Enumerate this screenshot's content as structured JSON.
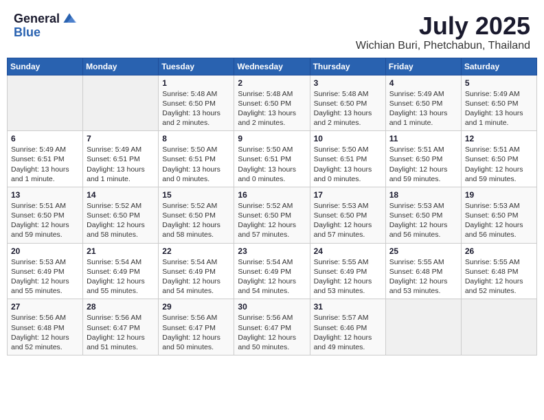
{
  "header": {
    "logo_general": "General",
    "logo_blue": "Blue",
    "month": "July 2025",
    "location": "Wichian Buri, Phetchabun, Thailand"
  },
  "weekdays": [
    "Sunday",
    "Monday",
    "Tuesday",
    "Wednesday",
    "Thursday",
    "Friday",
    "Saturday"
  ],
  "weeks": [
    [
      {
        "day": "",
        "info": ""
      },
      {
        "day": "",
        "info": ""
      },
      {
        "day": "1",
        "info": "Sunrise: 5:48 AM\nSunset: 6:50 PM\nDaylight: 13 hours and 2 minutes."
      },
      {
        "day": "2",
        "info": "Sunrise: 5:48 AM\nSunset: 6:50 PM\nDaylight: 13 hours and 2 minutes."
      },
      {
        "day": "3",
        "info": "Sunrise: 5:48 AM\nSunset: 6:50 PM\nDaylight: 13 hours and 2 minutes."
      },
      {
        "day": "4",
        "info": "Sunrise: 5:49 AM\nSunset: 6:50 PM\nDaylight: 13 hours and 1 minute."
      },
      {
        "day": "5",
        "info": "Sunrise: 5:49 AM\nSunset: 6:50 PM\nDaylight: 13 hours and 1 minute."
      }
    ],
    [
      {
        "day": "6",
        "info": "Sunrise: 5:49 AM\nSunset: 6:51 PM\nDaylight: 13 hours and 1 minute."
      },
      {
        "day": "7",
        "info": "Sunrise: 5:49 AM\nSunset: 6:51 PM\nDaylight: 13 hours and 1 minute."
      },
      {
        "day": "8",
        "info": "Sunrise: 5:50 AM\nSunset: 6:51 PM\nDaylight: 13 hours and 0 minutes."
      },
      {
        "day": "9",
        "info": "Sunrise: 5:50 AM\nSunset: 6:51 PM\nDaylight: 13 hours and 0 minutes."
      },
      {
        "day": "10",
        "info": "Sunrise: 5:50 AM\nSunset: 6:51 PM\nDaylight: 13 hours and 0 minutes."
      },
      {
        "day": "11",
        "info": "Sunrise: 5:51 AM\nSunset: 6:50 PM\nDaylight: 12 hours and 59 minutes."
      },
      {
        "day": "12",
        "info": "Sunrise: 5:51 AM\nSunset: 6:50 PM\nDaylight: 12 hours and 59 minutes."
      }
    ],
    [
      {
        "day": "13",
        "info": "Sunrise: 5:51 AM\nSunset: 6:50 PM\nDaylight: 12 hours and 59 minutes."
      },
      {
        "day": "14",
        "info": "Sunrise: 5:52 AM\nSunset: 6:50 PM\nDaylight: 12 hours and 58 minutes."
      },
      {
        "day": "15",
        "info": "Sunrise: 5:52 AM\nSunset: 6:50 PM\nDaylight: 12 hours and 58 minutes."
      },
      {
        "day": "16",
        "info": "Sunrise: 5:52 AM\nSunset: 6:50 PM\nDaylight: 12 hours and 57 minutes."
      },
      {
        "day": "17",
        "info": "Sunrise: 5:53 AM\nSunset: 6:50 PM\nDaylight: 12 hours and 57 minutes."
      },
      {
        "day": "18",
        "info": "Sunrise: 5:53 AM\nSunset: 6:50 PM\nDaylight: 12 hours and 56 minutes."
      },
      {
        "day": "19",
        "info": "Sunrise: 5:53 AM\nSunset: 6:50 PM\nDaylight: 12 hours and 56 minutes."
      }
    ],
    [
      {
        "day": "20",
        "info": "Sunrise: 5:53 AM\nSunset: 6:49 PM\nDaylight: 12 hours and 55 minutes."
      },
      {
        "day": "21",
        "info": "Sunrise: 5:54 AM\nSunset: 6:49 PM\nDaylight: 12 hours and 55 minutes."
      },
      {
        "day": "22",
        "info": "Sunrise: 5:54 AM\nSunset: 6:49 PM\nDaylight: 12 hours and 54 minutes."
      },
      {
        "day": "23",
        "info": "Sunrise: 5:54 AM\nSunset: 6:49 PM\nDaylight: 12 hours and 54 minutes."
      },
      {
        "day": "24",
        "info": "Sunrise: 5:55 AM\nSunset: 6:49 PM\nDaylight: 12 hours and 53 minutes."
      },
      {
        "day": "25",
        "info": "Sunrise: 5:55 AM\nSunset: 6:48 PM\nDaylight: 12 hours and 53 minutes."
      },
      {
        "day": "26",
        "info": "Sunrise: 5:55 AM\nSunset: 6:48 PM\nDaylight: 12 hours and 52 minutes."
      }
    ],
    [
      {
        "day": "27",
        "info": "Sunrise: 5:56 AM\nSunset: 6:48 PM\nDaylight: 12 hours and 52 minutes."
      },
      {
        "day": "28",
        "info": "Sunrise: 5:56 AM\nSunset: 6:47 PM\nDaylight: 12 hours and 51 minutes."
      },
      {
        "day": "29",
        "info": "Sunrise: 5:56 AM\nSunset: 6:47 PM\nDaylight: 12 hours and 50 minutes."
      },
      {
        "day": "30",
        "info": "Sunrise: 5:56 AM\nSunset: 6:47 PM\nDaylight: 12 hours and 50 minutes."
      },
      {
        "day": "31",
        "info": "Sunrise: 5:57 AM\nSunset: 6:46 PM\nDaylight: 12 hours and 49 minutes."
      },
      {
        "day": "",
        "info": ""
      },
      {
        "day": "",
        "info": ""
      }
    ]
  ]
}
